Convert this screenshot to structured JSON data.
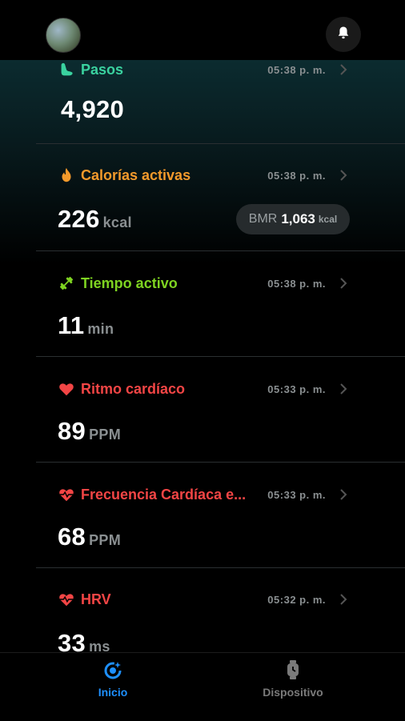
{
  "header": {
    "avatar_icon": "user-avatar",
    "bell_icon": "bell-icon"
  },
  "cards": [
    {
      "title": "Pasos",
      "title_color": "#3ad29f",
      "icon": "footprint-icon",
      "time": "05:38 p. m.",
      "value": "4,920",
      "unit": ""
    },
    {
      "title": "Calorías activas",
      "title_color": "#f39a2b",
      "icon": "flame-icon",
      "time": "05:38 p. m.",
      "value": "226",
      "unit": "kcal",
      "bmr": {
        "label": "BMR",
        "value": "1,063",
        "unit": "kcal"
      }
    },
    {
      "title": "Tiempo activo",
      "title_color": "#7ed321",
      "icon": "dumbbell-icon",
      "time": "05:38 p. m.",
      "value": "11",
      "unit": "min"
    },
    {
      "title": "Ritmo cardíaco",
      "title_color": "#f24545",
      "icon": "heart-icon",
      "time": "05:33 p. m.",
      "value": "89",
      "unit": "PPM"
    },
    {
      "title": "Frecuencia Cardíaca e...",
      "title_color": "#f24545",
      "icon": "heart-pulse-icon",
      "time": "05:33 p. m.",
      "value": "68",
      "unit": "PPM"
    },
    {
      "title": "HRV",
      "title_color": "#f24545",
      "icon": "heart-pulse-icon",
      "time": "05:32 p. m.",
      "value": "33",
      "unit": "ms"
    }
  ],
  "tabs": [
    {
      "label": "Inicio",
      "icon": "home-ring-icon",
      "active": true,
      "color": "#1e90ff"
    },
    {
      "label": "Dispositivo",
      "icon": "watch-icon",
      "active": false,
      "color": "#7a7a7a"
    }
  ]
}
